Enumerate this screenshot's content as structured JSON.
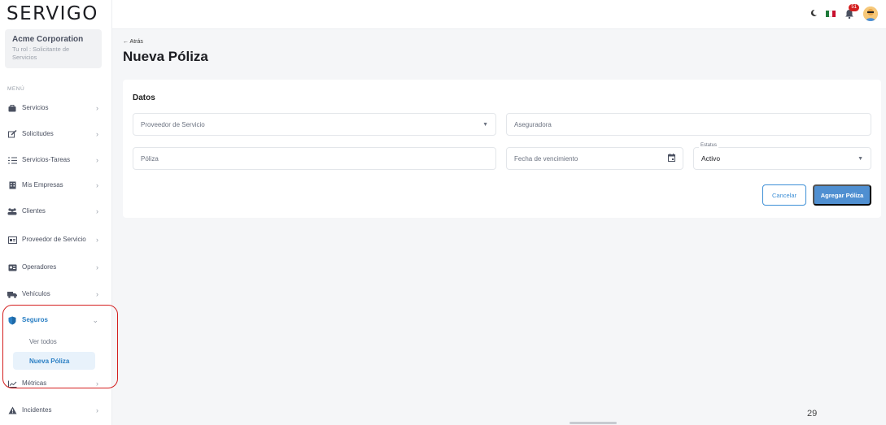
{
  "app": {
    "logo_text": "SERVIGO"
  },
  "org": {
    "name": "Acme Corporation",
    "role": "Tu rol : Solicitante de Servicios"
  },
  "sidebar": {
    "menu_label": "MENÚ",
    "items": [
      {
        "label": "Servicios",
        "icon": "briefcase-icon"
      },
      {
        "label": "Solicitudes",
        "icon": "edit-icon"
      },
      {
        "label": "Servicios-Tareas",
        "icon": "list-icon"
      },
      {
        "label": "Mis Empresas",
        "icon": "building-icon"
      },
      {
        "label": "Clientes",
        "icon": "users-icon"
      },
      {
        "label": "Proveedor de Servicio",
        "icon": "id-card-icon"
      },
      {
        "label": "Operadores",
        "icon": "contact-card-icon"
      },
      {
        "label": "Vehículos",
        "icon": "truck-icon"
      },
      {
        "label": "Seguros",
        "icon": "shield-icon"
      },
      {
        "label": "Métricas",
        "icon": "chart-line-icon"
      },
      {
        "label": "Incidentes",
        "icon": "warning-icon"
      }
    ],
    "seguros_sub": [
      {
        "label": "Ver todos"
      },
      {
        "label": "Nueva Póliza"
      }
    ]
  },
  "topbar": {
    "notifications_count": "51"
  },
  "main": {
    "back_label": "← Atrás",
    "title": "Nueva Póliza",
    "section_title": "Datos",
    "fields": {
      "proveedor_placeholder": "Proveedor de Servicio",
      "aseguradora_placeholder": "Aseguradora",
      "poliza_placeholder": "Póliza",
      "fecha_placeholder": "Fecha de vencimiento",
      "estatus_label": "Estatus",
      "estatus_value": "Activo"
    },
    "buttons": {
      "cancel": "Cancelar",
      "add": "Agregar Póliza"
    }
  },
  "footer": {
    "page_number": "29"
  },
  "colors": {
    "accent": "#4f8fd1",
    "highlight": "#d41f1f",
    "active_text": "#2a7fc4"
  }
}
